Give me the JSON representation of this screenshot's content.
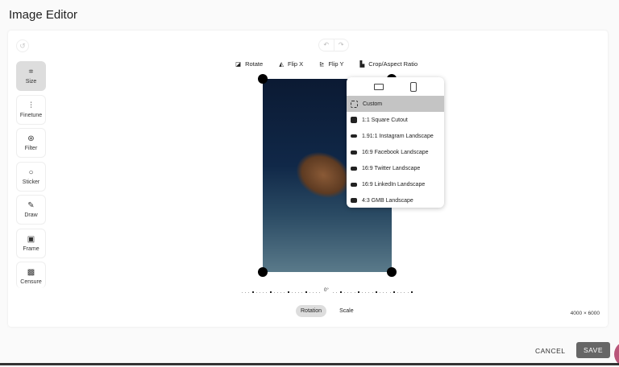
{
  "title": "Image Editor",
  "tools": [
    {
      "label": "Size",
      "icon": "crop-icon",
      "active": true
    },
    {
      "label": "Finetune",
      "icon": "sliders-icon"
    },
    {
      "label": "Filter",
      "icon": "filter-icon"
    },
    {
      "label": "Sticker",
      "icon": "sticker-icon"
    },
    {
      "label": "Draw",
      "icon": "pencil-icon"
    },
    {
      "label": "Frame",
      "icon": "frame-icon"
    },
    {
      "label": "Censure",
      "icon": "censure-icon"
    }
  ],
  "toolbar": {
    "rotate": "Rotate",
    "flip_x": "Flip X",
    "flip_y": "Flip Y",
    "crop": "Crop/Aspect Ratio"
  },
  "aspect_menu": {
    "items": [
      "Custom",
      "1:1 Square Cutout",
      "1.91:1 Instagram Landscape",
      "16:9 Facebook Landscape",
      "16:9 Twitter Landscape",
      "16:9 LinkedIn Landscape",
      "4:3 GMB Landscape"
    ],
    "selected": "Custom"
  },
  "rotation_value": "0°",
  "tabs": {
    "rotation": "Rotation",
    "scale": "Scale",
    "active": "Rotation"
  },
  "dimensions": "4000 × 6000",
  "footer": {
    "cancel": "CANCEL",
    "save": "SAVE"
  },
  "colors": {
    "save_bg": "#666666",
    "selected_row": "#c4c4c4",
    "active_tool": "#dddddd"
  }
}
